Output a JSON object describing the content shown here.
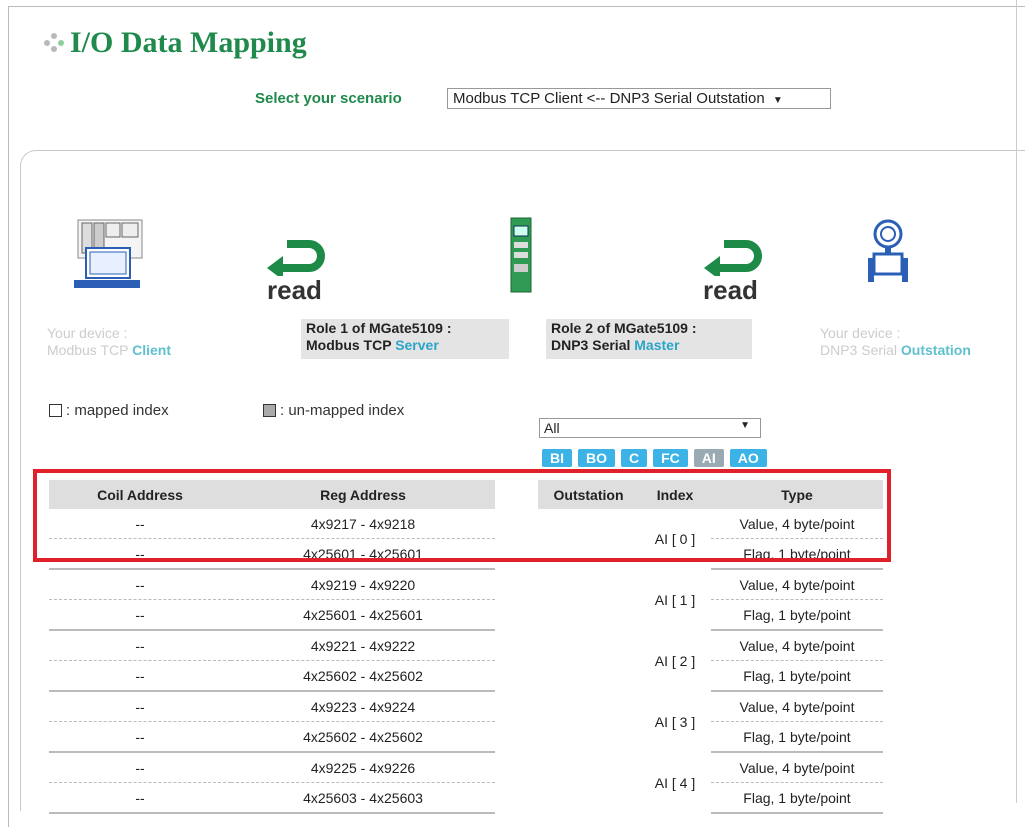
{
  "page": {
    "title": "I/O Data Mapping",
    "scenario_label": "Select your scenario",
    "scenario_value": "Modbus TCP Client <-- DNP3 Serial Outstation"
  },
  "devices": {
    "left_device_line1": "Your device :",
    "left_device_line2": "Modbus TCP",
    "left_device_role": "Client",
    "role1_line1": "Role 1 of MGate5109 :",
    "role1_line2": "Modbus TCP",
    "role1_role": "Server",
    "role2_line1": "Role 2 of MGate5109 :",
    "role2_line2": "DNP3 Serial",
    "role2_role": "Master",
    "right_device_line1": "Your device :",
    "right_device_line2": "DNP3 Serial",
    "right_device_role": "Outstation",
    "read1": "read",
    "read2": "read"
  },
  "legend": {
    "mapped": ": mapped index",
    "unmapped": ": un-mapped index"
  },
  "filter": {
    "value": "All",
    "types": [
      "BI",
      "BO",
      "C",
      "FC",
      "AI",
      "AO"
    ],
    "active": "AI"
  },
  "table": {
    "headers": [
      "Coil Address",
      "Reg Address",
      "Outstation",
      "Index",
      "Type"
    ],
    "rows": [
      {
        "index": "AI [ 0 ]",
        "a": {
          "coil": "--",
          "reg": "4x9217 - 4x9218",
          "type": "Value, 4 byte/point"
        },
        "b": {
          "coil": "--",
          "reg": "4x25601 - 4x25601",
          "type": "Flag, 1 byte/point"
        }
      },
      {
        "index": "AI [ 1 ]",
        "a": {
          "coil": "--",
          "reg": "4x9219 - 4x9220",
          "type": "Value, 4 byte/point"
        },
        "b": {
          "coil": "--",
          "reg": "4x25601 - 4x25601",
          "type": "Flag, 1 byte/point"
        }
      },
      {
        "index": "AI [ 2 ]",
        "a": {
          "coil": "--",
          "reg": "4x9221 - 4x9222",
          "type": "Value, 4 byte/point"
        },
        "b": {
          "coil": "--",
          "reg": "4x25602 - 4x25602",
          "type": "Flag, 1 byte/point"
        }
      },
      {
        "index": "AI [ 3 ]",
        "a": {
          "coil": "--",
          "reg": "4x9223 - 4x9224",
          "type": "Value, 4 byte/point"
        },
        "b": {
          "coil": "--",
          "reg": "4x25602 - 4x25602",
          "type": "Flag, 1 byte/point"
        }
      },
      {
        "index": "AI [ 4 ]",
        "a": {
          "coil": "--",
          "reg": "4x9225 - 4x9226",
          "type": "Value, 4 byte/point"
        },
        "b": {
          "coil": "--",
          "reg": "4x25603 - 4x25603",
          "type": "Flag, 1 byte/point"
        }
      }
    ]
  },
  "colors": {
    "title_green": "#1f8a4c",
    "accent_blue": "#3bb3e6",
    "highlight_red": "#e0202a"
  }
}
